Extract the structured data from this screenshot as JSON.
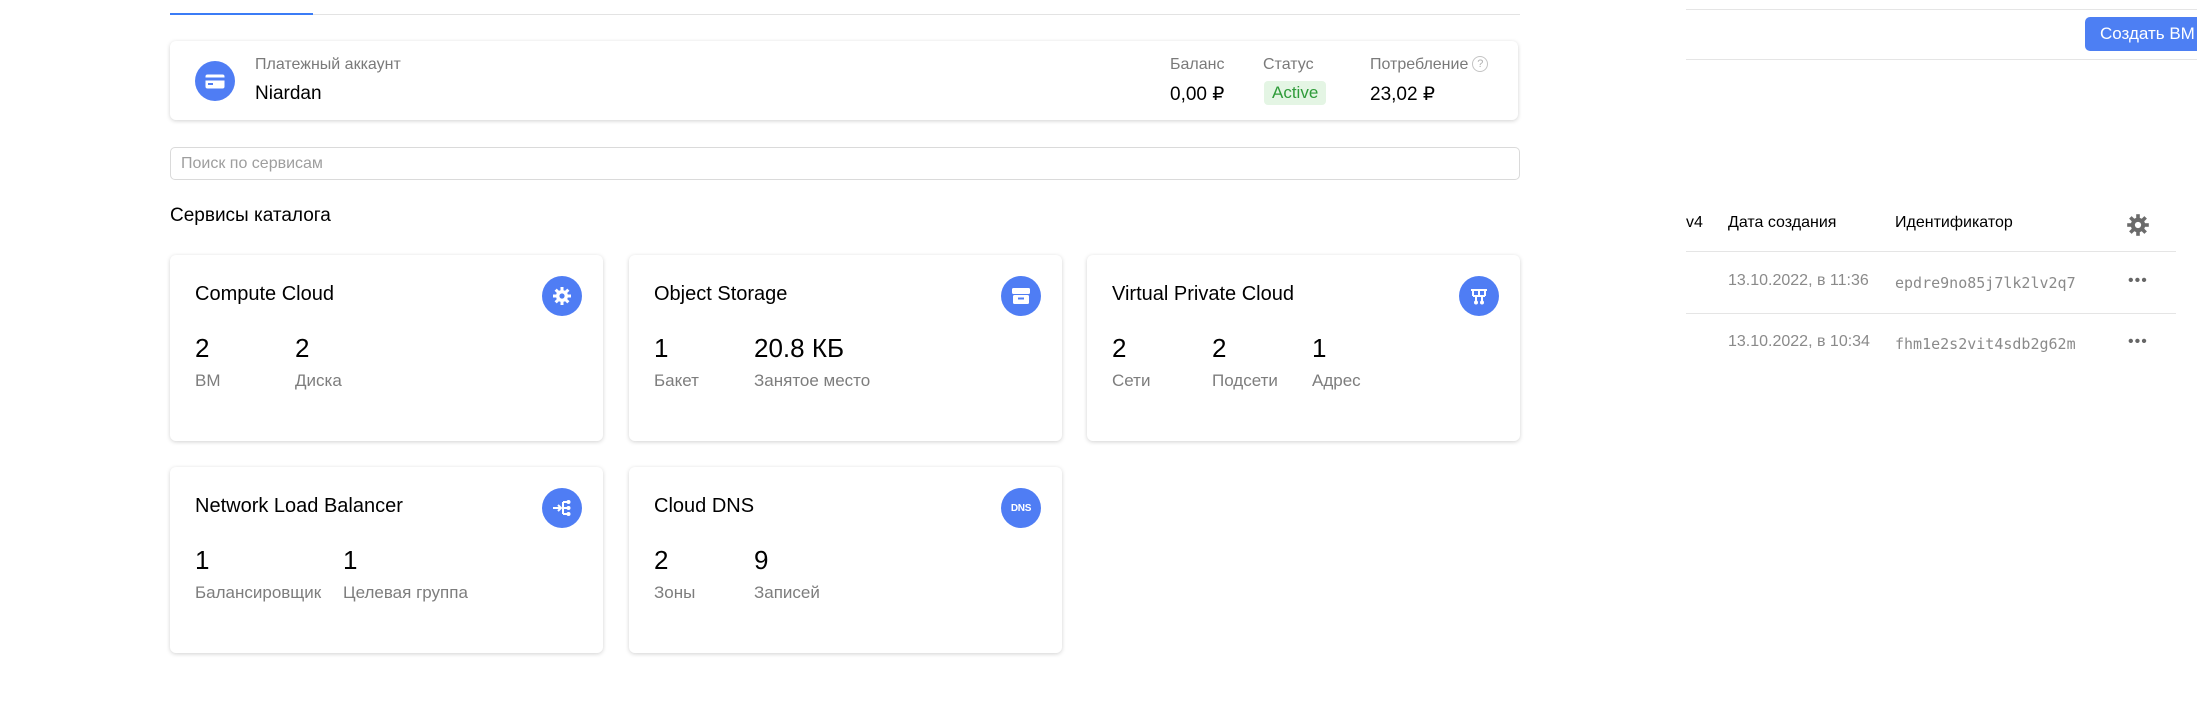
{
  "billing": {
    "label": "Платежный аккаунт",
    "name": "Niardan",
    "balance_label": "Баланс",
    "balance_value": "0,00 ₽",
    "status_label": "Статус",
    "status_value": "Active",
    "consumption_label": "Потребление",
    "consumption_help": "?",
    "consumption_value": "23,02 ₽"
  },
  "search": {
    "placeholder": "Поиск по сервисам"
  },
  "catalog": {
    "title": "Сервисы каталога",
    "cards": [
      {
        "title": "Compute Cloud",
        "icon": "gear-icon",
        "metrics": [
          {
            "value": "2",
            "label": "ВМ"
          },
          {
            "value": "2",
            "label": "Диска"
          }
        ]
      },
      {
        "title": "Object Storage",
        "icon": "storage-icon",
        "metrics": [
          {
            "value": "1",
            "label": "Бакет"
          },
          {
            "value": "20.8 КБ",
            "label": "Занятое место"
          }
        ]
      },
      {
        "title": "Virtual Private Cloud",
        "icon": "network-icon",
        "metrics": [
          {
            "value": "2",
            "label": "Сети"
          },
          {
            "value": "2",
            "label": "Подсети"
          },
          {
            "value": "1",
            "label": "Адрес"
          }
        ]
      },
      {
        "title": "Network Load Balancer",
        "icon": "balancer-icon",
        "metrics": [
          {
            "value": "1",
            "label": "Балансировщик"
          },
          {
            "value": "1",
            "label": "Целевая группа"
          }
        ]
      },
      {
        "title": "Cloud DNS",
        "icon": "dns-icon",
        "icon_text": "DNS",
        "metrics": [
          {
            "value": "2",
            "label": "Зоны"
          },
          {
            "value": "9",
            "label": "Записей"
          }
        ]
      }
    ]
  },
  "vm_panel": {
    "create_button": "Создать ВМ",
    "columns": {
      "ip_partial": "v4",
      "created": "Дата создания",
      "id": "Идентификатор"
    },
    "rows": [
      {
        "created": "13.10.2022, в 11:36",
        "id": "epdre9no85j7lk2lv2q7"
      },
      {
        "created": "13.10.2022, в 10:34",
        "id": "fhm1e2s2vit4sdb2g62m"
      }
    ],
    "row_menu": "•••"
  },
  "colors": {
    "accent": "#4f7df4",
    "status_bg": "#e4f5e4",
    "status_text": "#2e9b39"
  }
}
